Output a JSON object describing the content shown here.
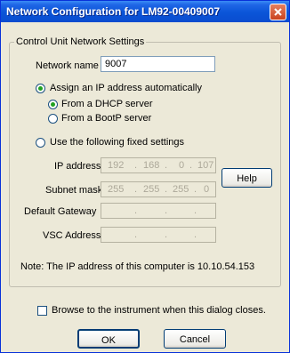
{
  "window": {
    "title": "Network Configuration for LM92-00409007"
  },
  "group": {
    "legend": "Control Unit Network Settings"
  },
  "network_name": {
    "label": "Network name",
    "value": "9007"
  },
  "assign_auto": {
    "label": "Assign an IP address automatically",
    "selected": true
  },
  "dhcp": {
    "label": "From a DHCP server",
    "selected": true
  },
  "bootp": {
    "label": "From a BootP server",
    "selected": false
  },
  "fixed": {
    "label": "Use the following fixed settings",
    "selected": false
  },
  "ip_address": {
    "label": "IP address",
    "octets": [
      "192",
      "168",
      "0",
      "107"
    ]
  },
  "subnet_mask": {
    "label": "Subnet mask",
    "octets": [
      "255",
      "255",
      "255",
      "0"
    ]
  },
  "gateway": {
    "label": "Default Gateway",
    "octets": [
      "",
      "",
      "",
      ""
    ]
  },
  "vsc": {
    "label": "VSC Address",
    "octets": [
      "",
      "",
      "",
      ""
    ]
  },
  "dot": ".",
  "help_label": "Help",
  "note": "Note:  The IP address of this computer is 10.10.54.153",
  "browse": {
    "label": "Browse to the instrument when this dialog closes.",
    "checked": false
  },
  "ok_label": "OK",
  "cancel_label": "Cancel"
}
